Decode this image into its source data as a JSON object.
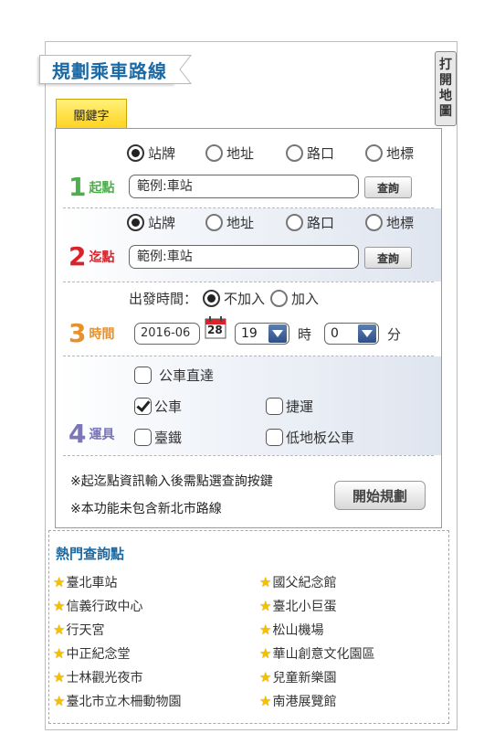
{
  "title": "規劃乘車路線",
  "open_map": [
    "打",
    "開",
    "地",
    "圖"
  ],
  "keyword_tab": "關鍵字",
  "origin": {
    "num": "1",
    "label": "起點",
    "options": [
      "站牌",
      "地址",
      "路口",
      "地標"
    ],
    "selected": "站牌",
    "placeholder": "範例:車站",
    "query_label": "查詢"
  },
  "destination": {
    "num": "2",
    "label": "迄點",
    "options": [
      "站牌",
      "地址",
      "路口",
      "地標"
    ],
    "selected": "站牌",
    "placeholder": "範例:車站",
    "query_label": "查詢"
  },
  "time": {
    "num": "3",
    "label": "時間",
    "depart_label": "出發時間：",
    "opt_none": "不加入",
    "opt_add": "加入",
    "selected": "不加入",
    "date_value": "2016-06",
    "calendar_day": "28",
    "hour_value": "19",
    "hour_unit": "時",
    "minute_value": "0",
    "minute_unit": "分"
  },
  "vehicle": {
    "num": "4",
    "label": "運具",
    "direct_bus": "公車直達",
    "bus": "公車",
    "metro": "捷運",
    "rail": "臺鐵",
    "low_floor_bus": "低地板公車",
    "checked": [
      "公車"
    ]
  },
  "notes": [
    "※起迄點資訊輸入後需點選查詢按鍵",
    "※本功能未包含新北市路線"
  ],
  "start_button": "開始規劃",
  "hot_points": {
    "title": "熱門查詢點",
    "left": [
      "臺北車站",
      "信義行政中心",
      "行天宮",
      "中正紀念堂",
      "士林觀光夜市",
      "臺北市立木柵動物園"
    ],
    "right": [
      "國父紀念館",
      "臺北小巨蛋",
      "松山機場",
      "華山創意文化園區",
      "兒童新樂園",
      "南港展覽館"
    ]
  },
  "colors": {
    "title_blue": "#1b6aa5",
    "num1_green": "#4bb04a",
    "num2_red": "#d9232a",
    "num3_orange": "#e8902a",
    "num4_purple": "#7b76b8",
    "keyword_yellow": "#ffd21e"
  }
}
